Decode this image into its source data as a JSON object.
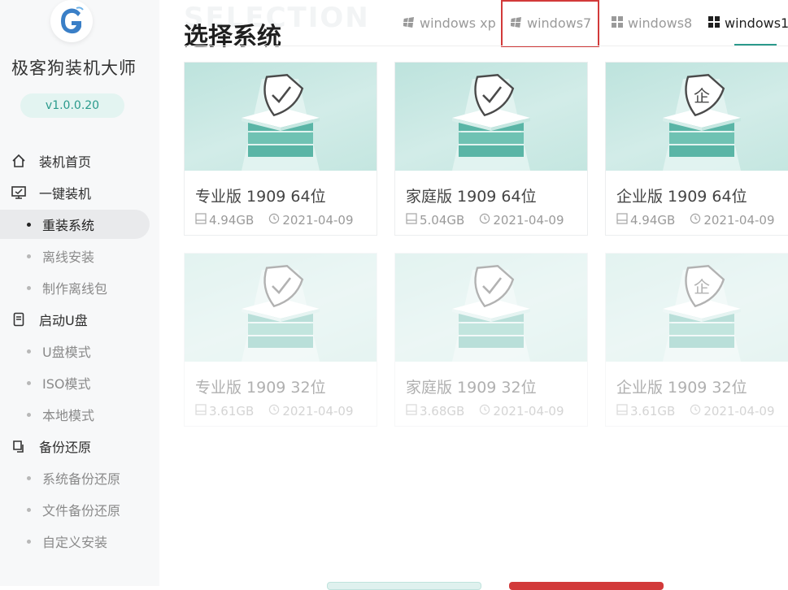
{
  "app": {
    "title": "极客狗装机大师",
    "version": "v1.0.0.20"
  },
  "sidebar": {
    "groups": [
      {
        "label": "装机首页",
        "icon": "home-icon"
      },
      {
        "label": "一键装机",
        "icon": "monitor-icon",
        "items": [
          "重装系统",
          "离线安装",
          "制作离线包"
        ],
        "active_item": "重装系统"
      },
      {
        "label": "启动U盘",
        "icon": "usb-drive-icon",
        "items": [
          "U盘模式",
          "ISO模式",
          "本地模式"
        ]
      },
      {
        "label": "备份还原",
        "icon": "backup-icon",
        "items": [
          "系统备份还原",
          "文件备份还原",
          "自定义安装"
        ]
      }
    ]
  },
  "main": {
    "watermark": "SELECTION",
    "title": "选择系统",
    "tabs": [
      {
        "label": "windows xp",
        "active": false
      },
      {
        "label": "windows7",
        "active": false,
        "highlighted": true
      },
      {
        "label": "windows8",
        "active": false
      },
      {
        "label": "windows1",
        "active": true
      }
    ],
    "cards": [
      {
        "name": "专业版 1909 64位",
        "size": "4.94GB",
        "date": "2021-04-09",
        "badge": "check",
        "faded": false
      },
      {
        "name": "家庭版 1909 64位",
        "size": "5.04GB",
        "date": "2021-04-09",
        "badge": "check",
        "faded": false
      },
      {
        "name": "企业版 1909 64位",
        "size": "4.94GB",
        "date": "2021-04-09",
        "badge": "企",
        "faded": false
      },
      {
        "name": "专业版 1909 32位",
        "size": "3.61GB",
        "date": "2021-04-09",
        "badge": "check",
        "faded": true
      },
      {
        "name": "家庭版 1909 32位",
        "size": "3.68GB",
        "date": "2021-04-09",
        "badge": "check",
        "faded": true
      },
      {
        "name": "企业版 1909 32位",
        "size": "3.61GB",
        "date": "2021-04-09",
        "badge": "企",
        "faded": true
      }
    ]
  },
  "colors": {
    "accent": "#2a9a8c",
    "highlight_red": "#d23a3a"
  }
}
